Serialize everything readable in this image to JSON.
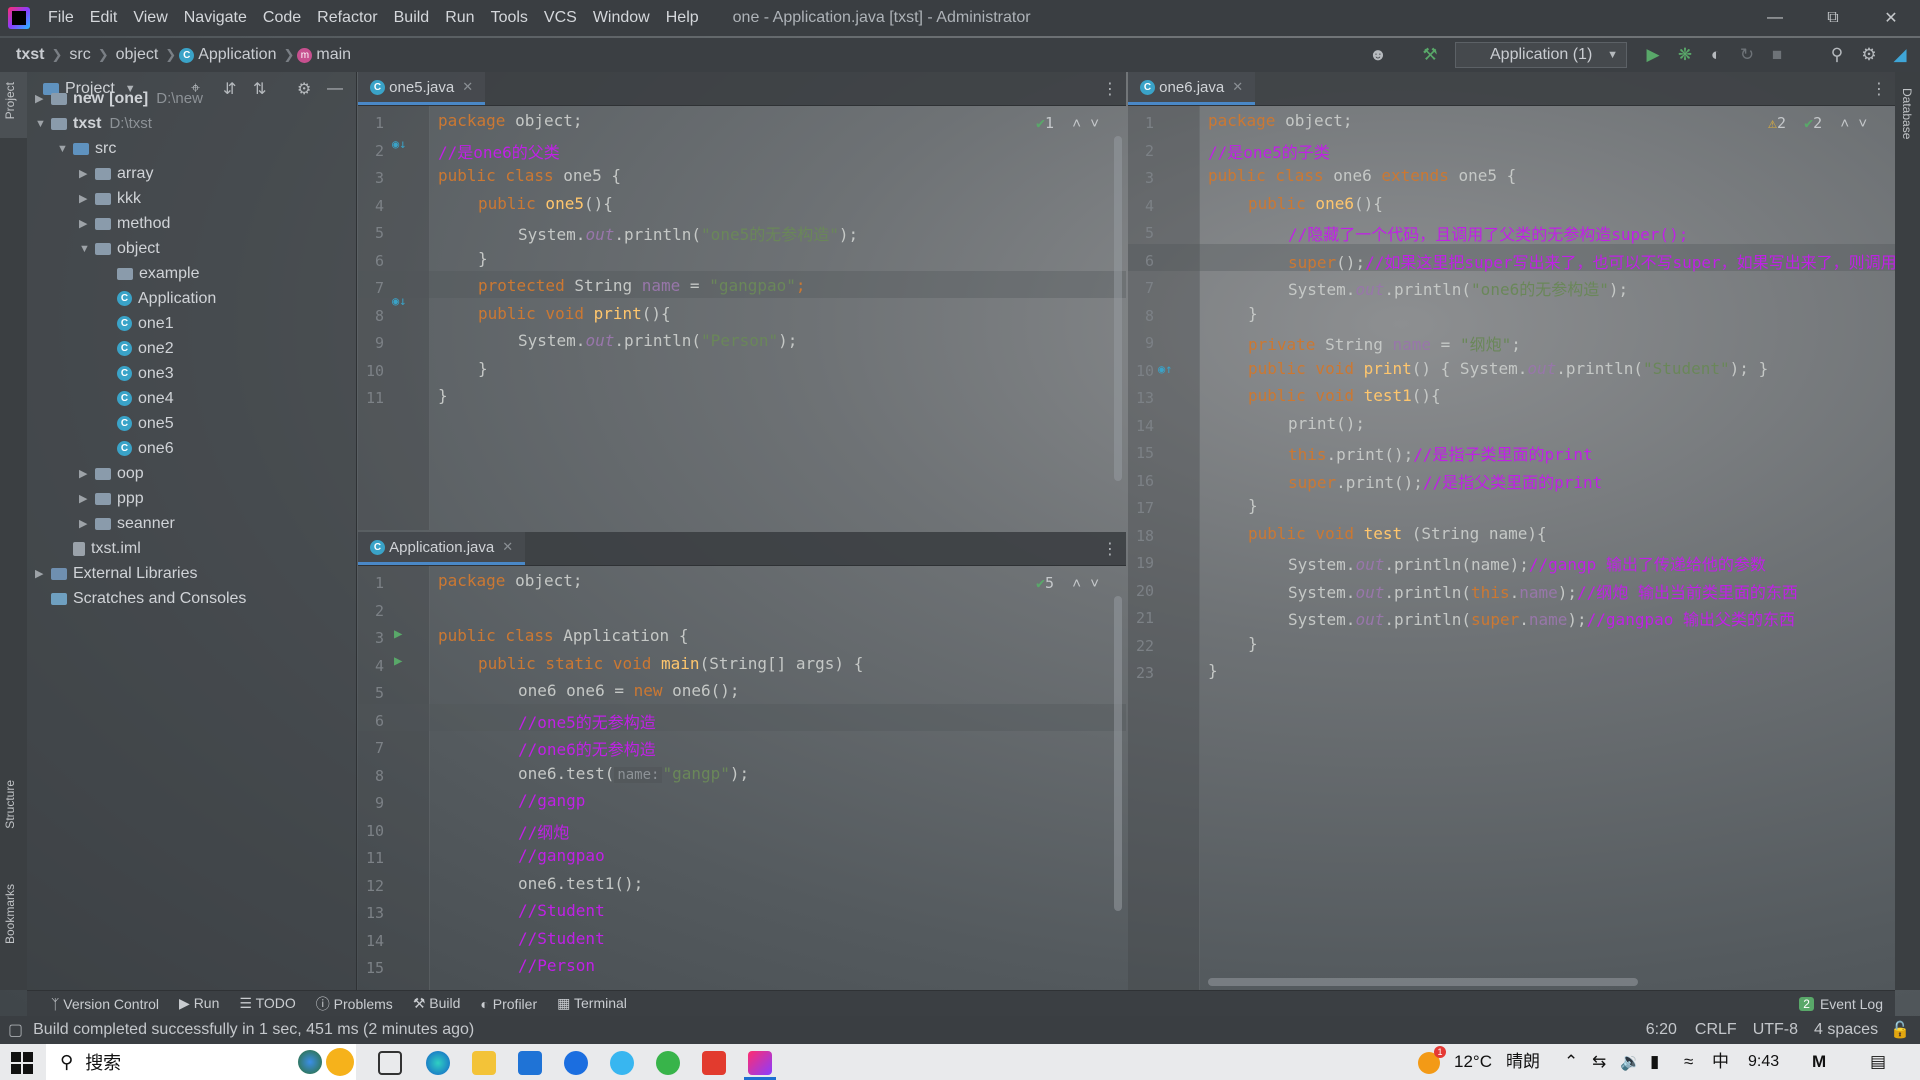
{
  "menubar": {
    "items": [
      "File",
      "Edit",
      "View",
      "Navigate",
      "Code",
      "Refactor",
      "Build",
      "Run",
      "Tools",
      "VCS",
      "Window",
      "Help"
    ],
    "title": "one - Application.java [txst] - Administrator"
  },
  "navbar": {
    "crumbs": [
      "txst",
      "src",
      "object",
      "Application",
      "main"
    ],
    "run_config": "Application (1)"
  },
  "sidestrip": {
    "project": "Project",
    "structure": "Structure",
    "bookmarks": "Bookmarks",
    "database": "Database"
  },
  "project": {
    "title": "Project",
    "tree": [
      {
        "label": "new",
        "bold": "[one]",
        "hint": "D:\\new",
        "depth": 0,
        "arrow": "▶"
      },
      {
        "label": "txst",
        "hint": "D:\\txst",
        "depth": 0,
        "arrow": "▼"
      },
      {
        "label": "src",
        "depth": 1,
        "arrow": "▼"
      },
      {
        "label": "array",
        "depth": 2,
        "arrow": "▶"
      },
      {
        "label": "kkk",
        "depth": 2,
        "arrow": "▶"
      },
      {
        "label": "method",
        "depth": 2,
        "arrow": "▶"
      },
      {
        "label": "object",
        "depth": 2,
        "arrow": "▼"
      },
      {
        "label": "example",
        "depth": 3
      },
      {
        "label": "Application",
        "depth": 3
      },
      {
        "label": "one1",
        "depth": 3
      },
      {
        "label": "one2",
        "depth": 3
      },
      {
        "label": "one3",
        "depth": 3
      },
      {
        "label": "one4",
        "depth": 3
      },
      {
        "label": "one5",
        "depth": 3
      },
      {
        "label": "one6",
        "depth": 3
      },
      {
        "label": "oop",
        "depth": 2,
        "arrow": "▶"
      },
      {
        "label": "ppp",
        "depth": 2,
        "arrow": "▶"
      },
      {
        "label": "seanner",
        "depth": 2,
        "arrow": "▶"
      },
      {
        "label": "txst.iml",
        "depth": 1
      },
      {
        "label": "External Libraries",
        "depth": 0,
        "arrow": "▶"
      },
      {
        "label": "Scratches and Consoles",
        "depth": 0
      }
    ]
  },
  "editors": {
    "one5": {
      "tab": "one5.java",
      "line_numbers": [
        "1",
        "2",
        "3",
        "4",
        "5",
        "6",
        "7",
        "8",
        "9",
        "10",
        "11"
      ],
      "checks": "1",
      "code": {
        "l1_kw": "package",
        "l1_rest": " object;",
        "l2_cm": "//是one6的父类",
        "l3_kw": "public class",
        "l3_rest": " one5 {",
        "l4_kw": "public",
        "l4_fn": " one5",
        "l4_rest": "(){",
        "l5_a": "System.",
        "l5_it": "out",
        "l5_b": ".println(",
        "l5_str": "\"one5的无参构造\"",
        "l5_c": ");",
        "l6": "}",
        "l7_kw": "protected",
        "l7_a": " String ",
        "l7_fld": "name",
        "l7_b": " = ",
        "l7_str": "\"gangpao\"",
        "l7_c": ";",
        "l8_kw": "public void",
        "l8_fn": " print",
        "l8_rest": "(){",
        "l9_a": "System.",
        "l9_it": "out",
        "l9_b": ".println(",
        "l9_str": "\"Person\"",
        "l9_c": ");",
        "l10": "}",
        "l11": "}"
      }
    },
    "app": {
      "tab": "Application.java",
      "line_numbers": [
        "1",
        "2",
        "3",
        "4",
        "5",
        "6",
        "7",
        "8",
        "9",
        "10",
        "11",
        "12",
        "13",
        "14",
        "15"
      ],
      "checks": "5",
      "code": {
        "l1_kw": "package",
        "l1_rest": " object;",
        "l3_kw": "public class",
        "l3_rest": " Application {",
        "l4_kw": "public static void",
        "l4_fn": " main",
        "l4_rest": "(String[] args) {",
        "l5_a": "one6 one6 = ",
        "l5_kw": "new",
        "l5_b": " one6();",
        "l6_cm": "//one5的无参构造",
        "l7_cm": "//one6的无参构造",
        "l8_a": "one6.test(",
        "l8_hint": "name:",
        "l8_str": "\"gangp\"",
        "l8_b": ");",
        "l9_cm": "//gangp",
        "l10_cm": "//纲炮",
        "l11_cm": "//gangpao",
        "l12_a": "one6.test1();",
        "l13_cm": "//Student",
        "l14_cm": "//Student",
        "l15_cm": "//Person"
      }
    },
    "one6": {
      "tab": "one6.java",
      "line_numbers": [
        "1",
        "2",
        "3",
        "4",
        "5",
        "6",
        "7",
        "8",
        "9",
        "10",
        "13",
        "14",
        "15",
        "16",
        "17",
        "18",
        "19",
        "20",
        "21",
        "22",
        "23"
      ],
      "warnings": "2",
      "checks": "2",
      "code": {
        "l1_kw": "package",
        "l1_rest": " object;",
        "l2_cm": "//是one5的子类",
        "l3_kw": "public class",
        "l3_a": " one6 ",
        "l3_kw2": "extends",
        "l3_b": " one5 {",
        "l4_kw": "public",
        "l4_fn": " one6",
        "l4_rest": "(){",
        "l5_cm": "//隐藏了一个代码，且调用了父类的无参构造super();",
        "l6_kw": "super",
        "l6_a": "();",
        "l6_cm": "//如果这里把super写出来了，也可以不写super，如果写出来了，则调用",
        "l7_a": "System.",
        "l7_it": "out",
        "l7_b": ".println(",
        "l7_str": "\"one6的无参构造\"",
        "l7_c": ");",
        "l8": "}",
        "l9_kw": "private",
        "l9_a": " String ",
        "l9_fld": "name",
        "l9_b": " = ",
        "l9_str": "\"纲炮\"",
        "l9_c": ";",
        "l10_kw": "public void",
        "l10_fn": " print",
        "l10_a": "() { System.",
        "l10_it": "out",
        "l10_b": ".println(",
        "l10_str": "\"Student\"",
        "l10_c": "); }",
        "l13_kw": "public void",
        "l13_fn": " test1",
        "l13_rest": "(){",
        "l14": "print();",
        "l15_kw": "this",
        "l15_a": ".print();",
        "l15_cm": "//是指子类里面的print",
        "l16_kw": "super",
        "l16_a": ".print();",
        "l16_cm": "//是指父类里面的print",
        "l17": "}",
        "l18_kw": "public void",
        "l18_fn": " test",
        "l18_rest": " (String name){",
        "l19_a": "System.",
        "l19_it": "out",
        "l19_b": ".println(name);",
        "l19_cm": "//gangp 输出了传递给他的参数",
        "l20_a": "System.",
        "l20_it": "out",
        "l20_b": ".println(",
        "l20_kw": "this",
        "l20_c": ".",
        "l20_fld": "name",
        "l20_d": ");",
        "l20_cm": "//纲炮 输出当前类里面的东西",
        "l21_a": "System.",
        "l21_it": "out",
        "l21_b": ".println(",
        "l21_kw": "super",
        "l21_c": ".",
        "l21_fld": "name",
        "l21_d": ");",
        "l21_cm": "//gangpao 输出父类的东西",
        "l22": "}",
        "l23": "}"
      }
    }
  },
  "bottom_tabs": [
    "Version Control",
    "Run",
    "TODO",
    "Problems",
    "Build",
    "Profiler",
    "Terminal"
  ],
  "event_log": {
    "count": "2",
    "label": "Event Log"
  },
  "status": {
    "message": "Build completed successfully in 1 sec, 451 ms (2 minutes ago)",
    "position": "6:20",
    "line_sep": "CRLF",
    "encoding": "UTF-8",
    "indent": "4 spaces"
  },
  "taskbar": {
    "search": "搜索",
    "weather_badge": "1",
    "temp": "12°C",
    "weather": "晴朗",
    "ime": "中",
    "time": "9:43"
  },
  "colors": {
    "keyword": "#cc7832",
    "function": "#ffc66d",
    "string": "#6a8759",
    "comment": "#c020e6",
    "field": "#9876aa"
  }
}
